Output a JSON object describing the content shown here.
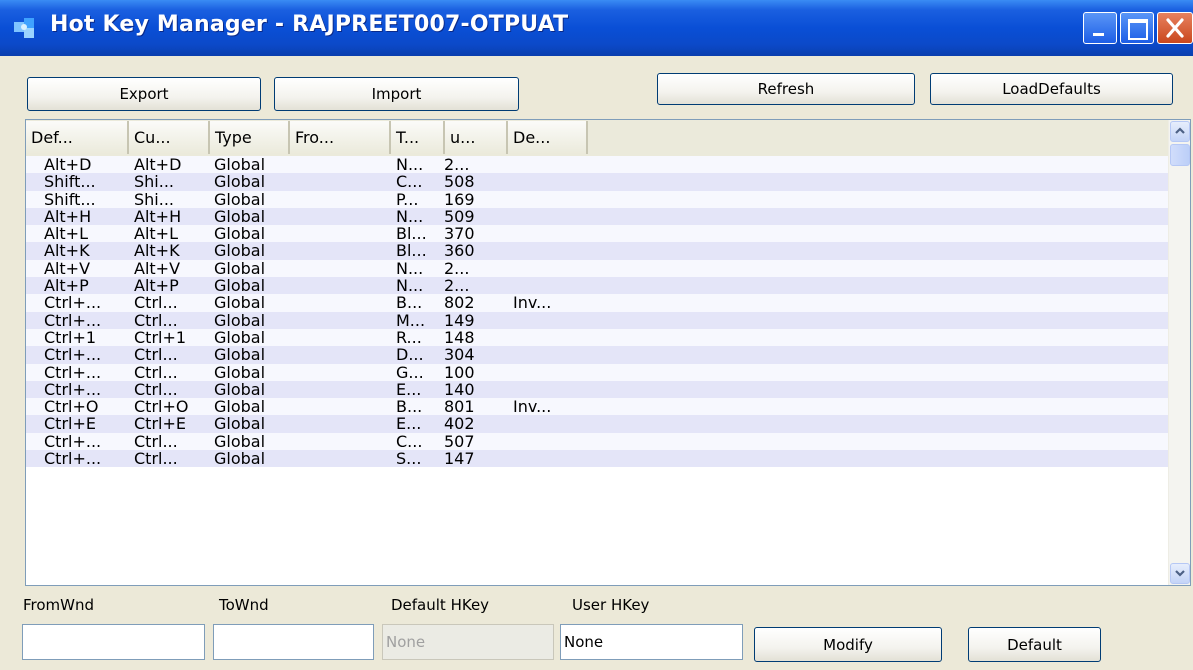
{
  "window": {
    "title": "Hot Key Manager - RAJPREET007-OTPUAT",
    "icon": "puzzle-app-icon"
  },
  "toolbar": {
    "export_label": "Export",
    "import_label": "Import",
    "refresh_label": "Refresh",
    "loaddefaults_label": "LoadDefaults"
  },
  "list": {
    "columns": [
      "Def...",
      "Cu...",
      "Type",
      "Fro...",
      "T...",
      "u...",
      "De..."
    ],
    "rows": [
      [
        "Alt+D",
        "Alt+D",
        "Global",
        "",
        "N...",
        "2...",
        ""
      ],
      [
        "Shift...",
        "Shi...",
        "Global",
        "",
        "C...",
        "508",
        ""
      ],
      [
        "Shift...",
        "Shi...",
        "Global",
        "",
        "P...",
        "169",
        ""
      ],
      [
        "Alt+H",
        "Alt+H",
        "Global",
        "",
        "N...",
        "509",
        ""
      ],
      [
        "Alt+L",
        "Alt+L",
        "Global",
        "",
        "Bl...",
        "370",
        ""
      ],
      [
        "Alt+K",
        "Alt+K",
        "Global",
        "",
        "Bl...",
        "360",
        ""
      ],
      [
        "Alt+V",
        "Alt+V",
        "Global",
        "",
        "N...",
        "2...",
        ""
      ],
      [
        "Alt+P",
        "Alt+P",
        "Global",
        "",
        "N...",
        "2...",
        ""
      ],
      [
        "Ctrl+...",
        "Ctrl...",
        "Global",
        "",
        "B...",
        "802",
        "Inv..."
      ],
      [
        "Ctrl+...",
        "Ctrl...",
        "Global",
        "",
        "M...",
        "149",
        ""
      ],
      [
        "Ctrl+1",
        "Ctrl+1",
        "Global",
        "",
        "R...",
        "148",
        ""
      ],
      [
        "Ctrl+...",
        "Ctrl...",
        "Global",
        "",
        "D...",
        "304",
        ""
      ],
      [
        "Ctrl+...",
        "Ctrl...",
        "Global",
        "",
        "G...",
        "100",
        ""
      ],
      [
        "Ctrl+...",
        "Ctrl...",
        "Global",
        "",
        "E...",
        "140",
        ""
      ],
      [
        "Ctrl+O",
        "Ctrl+O",
        "Global",
        "",
        "B...",
        "801",
        "Inv..."
      ],
      [
        "Ctrl+E",
        "Ctrl+E",
        "Global",
        "",
        "E...",
        "402",
        ""
      ],
      [
        "Ctrl+...",
        "Ctrl...",
        "Global",
        "",
        "C...",
        "507",
        ""
      ],
      [
        "Ctrl+...",
        "Ctrl...",
        "Global",
        "",
        "S...",
        "147",
        ""
      ]
    ]
  },
  "bottom": {
    "fromwnd_label": "FromWnd",
    "townd_label": "ToWnd",
    "default_hkey_label": "Default HKey",
    "user_hkey_label": "User HKey",
    "fromwnd_value": "",
    "townd_value": "",
    "default_hkey_value": "None",
    "user_hkey_value": "None",
    "modify_label": "Modify",
    "default_label": "Default"
  },
  "colors": {
    "titlebar": "#0a4fd6",
    "row_odd": "#f7f8fe",
    "row_even": "#e4e5f8",
    "face": "#ece9d8"
  }
}
